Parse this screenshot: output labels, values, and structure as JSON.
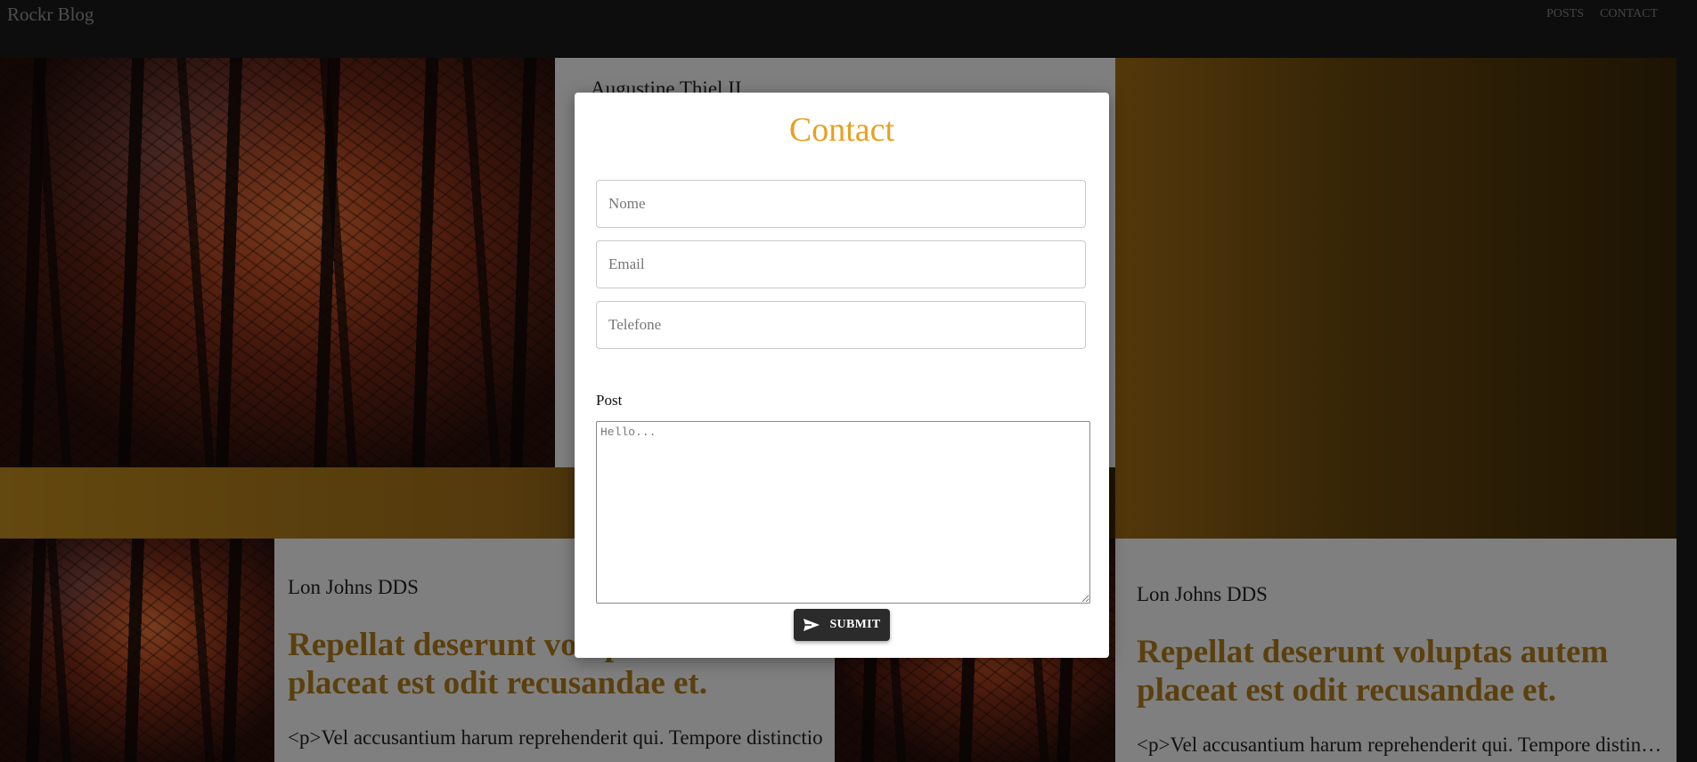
{
  "navbar": {
    "brand": "Rockr Blog",
    "links": [
      "POSTS",
      "CONTACT"
    ]
  },
  "background": {
    "top_card": {
      "author": "Augustine Thiel II"
    },
    "bottom_left_card": {
      "author": "Lon Johns DDS",
      "title": "Repellat deserunt voluptas autem placeat est odit recusandae et.",
      "excerpt": "<p>Vel accusantium harum reprehenderit qui. Tempore distinctio"
    },
    "bottom_right_card": {
      "author": "Lon Johns DDS",
      "title": "Repellat deserunt voluptas autem placeat est odit recusandae et.",
      "excerpt": "<p>Vel accusantium harum reprehenderit qui. Tempore distinctio"
    }
  },
  "modal": {
    "title": "Contact",
    "name_placeholder": "Nome",
    "email_placeholder": "Email",
    "phone_placeholder": "Telefone",
    "post_label": "Post",
    "post_placeholder": "Hello...",
    "submit_label": "SUBMIT",
    "submit_icon": "send-icon"
  },
  "colors": {
    "accent": "#e8a020",
    "card_title": "#b7801d",
    "navbar": "#1b1b1b",
    "button": "#2b2b2b"
  }
}
